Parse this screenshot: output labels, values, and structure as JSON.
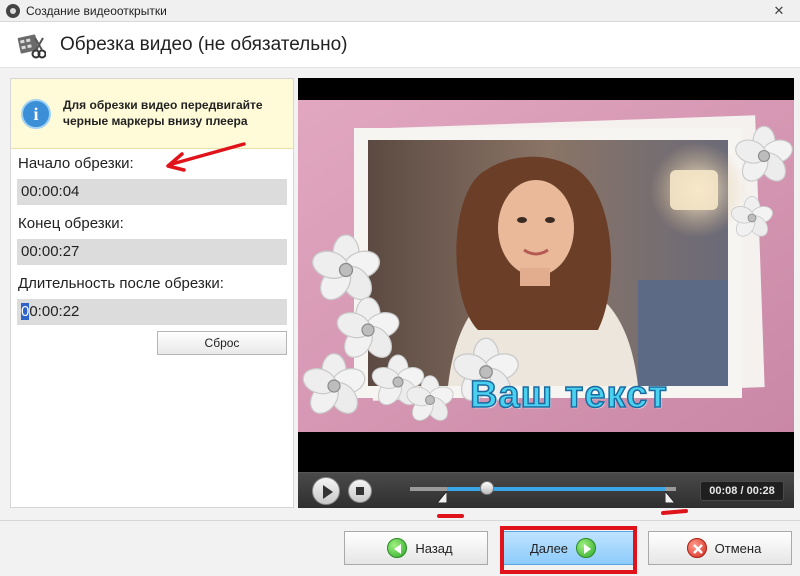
{
  "window": {
    "title": "Создание видеооткрытки",
    "close_glyph": "✕"
  },
  "header": {
    "title": "Обрезка видео (не обязательно)",
    "icon": "film-scissors-icon"
  },
  "info": {
    "icon": "info-icon",
    "glyph": "i",
    "text": "Для обрезки видео передвигайте черные маркеры внизу плеера"
  },
  "fields": {
    "start": {
      "label": "Начало обрезки:",
      "value": "00:00:04"
    },
    "end": {
      "label": "Конец обрезки:",
      "value": "00:00:27"
    },
    "duration": {
      "label": "Длительность после обрезки:",
      "value_selected": "0",
      "value_rest": "0:00:22"
    }
  },
  "reset_button": {
    "label": "Сброс"
  },
  "player": {
    "overlay_text": "Ваш текст",
    "timecode": "00:08 / 00:28",
    "position_fraction": 0.29,
    "trim_start_fraction": 0.14,
    "trim_end_fraction": 0.96
  },
  "footer": {
    "back_label": "Назад",
    "next_label": "Далее",
    "cancel_label": "Отмена"
  },
  "colors": {
    "accent_blue": "#3aa6e8",
    "annotation_red": "#e0121a",
    "info_bg": "#fffbd9",
    "next_button": "#8ccbfb"
  }
}
